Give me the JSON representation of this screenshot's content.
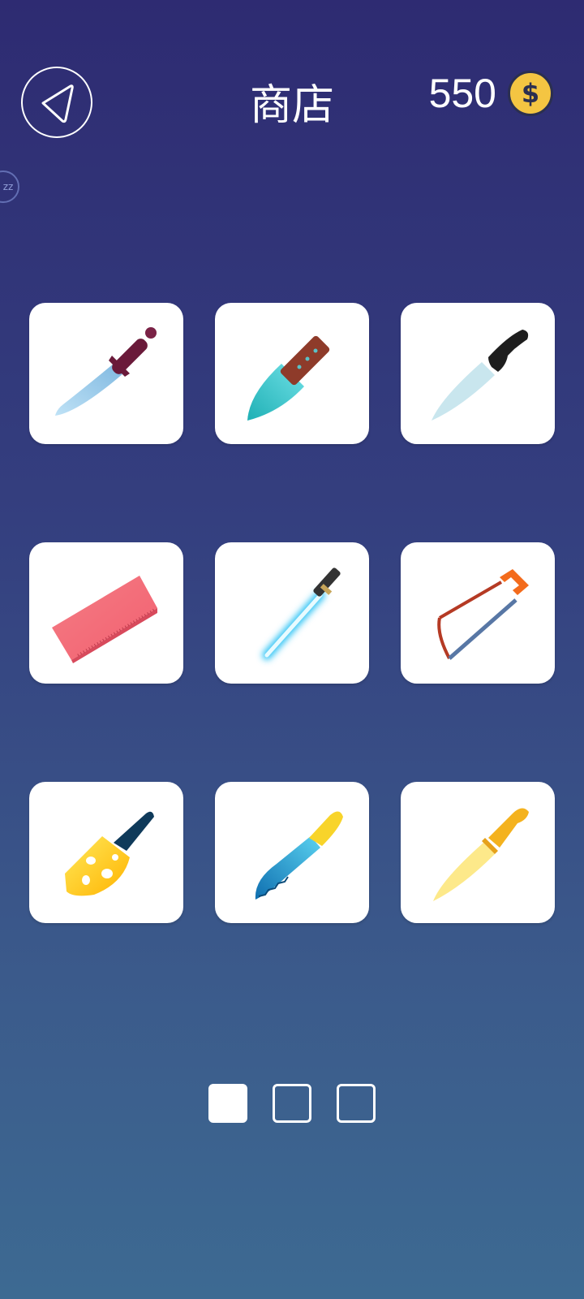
{
  "header": {
    "title": "商店",
    "coins": "550",
    "coin_symbol": "$"
  },
  "side_badge": "zz",
  "shop": {
    "items": [
      {
        "icon": "hunting-knife-icon"
      },
      {
        "icon": "chef-knife-icon"
      },
      {
        "icon": "kitchen-knife-icon"
      },
      {
        "icon": "ruler-icon"
      },
      {
        "icon": "lightsaber-icon"
      },
      {
        "icon": "hacksaw-icon"
      },
      {
        "icon": "cheese-knife-icon"
      },
      {
        "icon": "bread-knife-icon"
      },
      {
        "icon": "golden-knife-icon"
      }
    ]
  },
  "pager": {
    "pages": 3,
    "active": 1
  },
  "colors": {
    "background_top": "#2e2b72",
    "background_bottom": "#3d6a92",
    "tile": "#ffffff",
    "coin": "#f4c542"
  }
}
